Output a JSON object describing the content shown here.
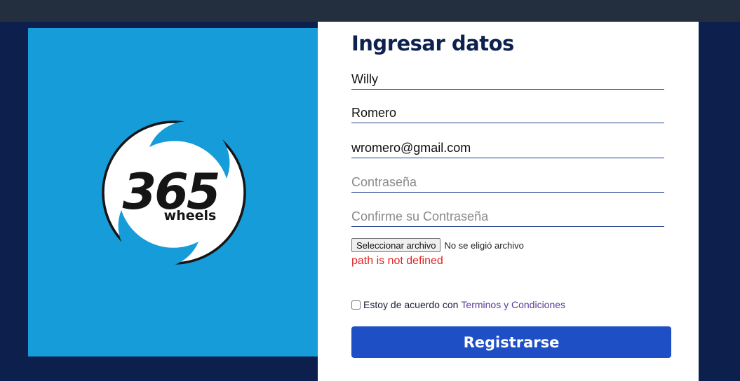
{
  "colors": {
    "page_background": "#0d1f4d",
    "top_bar": "#232f3e",
    "logo_panel": "#169cd8",
    "form_panel": "#ffffff",
    "title_text": "#0d2150",
    "error_text": "#e02424",
    "submit_button": "#1f4fc4",
    "link_text": "#5a3b9a"
  },
  "logo": {
    "icon": "365-wheels-logo",
    "number": "365",
    "word": "wheels"
  },
  "form": {
    "title": "Ingresar datos",
    "first_name": {
      "value": "Willy",
      "placeholder": ""
    },
    "last_name": {
      "value": "Romero",
      "placeholder": ""
    },
    "email": {
      "value": "wromero@gmail.com",
      "placeholder": ""
    },
    "password": {
      "value": "",
      "placeholder": "Contraseña"
    },
    "confirm_password": {
      "value": "",
      "placeholder": "Confirme su Contraseña"
    },
    "file": {
      "button_label": "Seleccionar archivo",
      "status": "No se eligió archivo"
    },
    "error_message": "path is not defined",
    "terms": {
      "checked": false,
      "label": "Estoy de acuerdo con",
      "link_label": "Terminos y Condiciones"
    },
    "submit_label": "Registrarse"
  }
}
